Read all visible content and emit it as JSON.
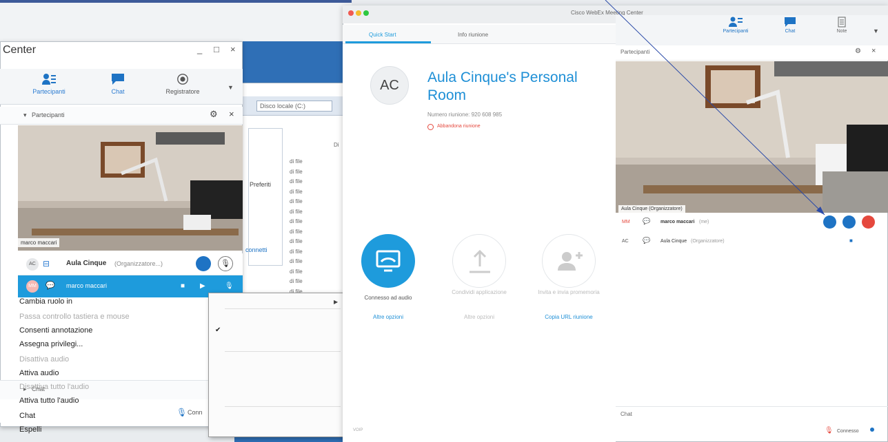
{
  "left_window": {
    "title": "Center",
    "controls": [
      "_",
      "□",
      "×"
    ],
    "toolbar": [
      {
        "label": "Partecipanti",
        "icon": "participants-icon"
      },
      {
        "label": "Chat",
        "icon": "chat-icon"
      },
      {
        "label": "Registratore",
        "icon": "record-icon"
      }
    ],
    "panel_title": "Partecipanti",
    "video_name": "marco maccari",
    "participants": [
      {
        "initials": "AC",
        "name": "Aula Cinque",
        "role": "(Organizzatore...)"
      },
      {
        "initials": "MM",
        "name": "marco maccari"
      }
    ],
    "chat_label": "Chat",
    "status_label": "Conn"
  },
  "background": {
    "drive_label": "Disco locale (C:)",
    "explorer_item": "Preferiti",
    "connect_label": "connetti",
    "file_label": "di file",
    "file_count": 14,
    "col_header": "Di"
  },
  "context_menu": {
    "items": [
      {
        "label": "Cambia ruolo in",
        "disabled": false,
        "submenu": true
      },
      {
        "label": "Passa controllo tastiera e mouse",
        "disabled": true
      },
      {
        "label": "Consenti annotazione",
        "disabled": false,
        "checked": true
      },
      {
        "label": "Assegna privilegi...",
        "disabled": false
      },
      {
        "label": "Disattiva audio",
        "disabled": true
      },
      {
        "label": "Attiva audio",
        "disabled": false
      },
      {
        "label": "Disattiva tutto l'audio",
        "disabled": true
      },
      {
        "label": "Attiva tutto l'audio",
        "disabled": false
      },
      {
        "label": "Chat",
        "disabled": false
      },
      {
        "label": "Espelli",
        "disabled": false
      }
    ]
  },
  "mac_window": {
    "title": "Cisco WebEx Meeting Center",
    "tabs": [
      "Quick Start",
      "Info riunione"
    ],
    "toolbar": [
      {
        "label": "Partecipanti",
        "icon": "participants-icon"
      },
      {
        "label": "Chat",
        "icon": "chat-icon"
      },
      {
        "label": "Note",
        "icon": "notes-icon"
      }
    ],
    "avatar_initials": "AC",
    "room_title": "Aula Cinque's Personal Room",
    "meeting_number": "Numero riunione: 920 608 985",
    "leave_label": "Abbandona riunione",
    "actions": [
      {
        "label": "Connesso ad audio",
        "link": "Altre opzioni"
      },
      {
        "label": "Condividi applicazione",
        "link": "Altre opzioni"
      },
      {
        "label": "Invita e invia promemoria",
        "link": "Copia URL riunione"
      }
    ],
    "participants_title": "Partecipanti",
    "video_name": "Aula Cinque (Organizzatore)",
    "participants": [
      {
        "initials": "MM",
        "name": "marco maccari",
        "note": "(me)"
      },
      {
        "initials": "AC",
        "name": "Aula Cinque",
        "role": "(Organizzatore)"
      }
    ],
    "chat_label": "Chat",
    "status_label": "Connesso",
    "bottom_left": "VOIP"
  },
  "colors": {
    "accent": "#1e9bdc",
    "title_blue": "#1e8fd6",
    "red": "#e5483d",
    "arrow": "#2a4aa8"
  }
}
